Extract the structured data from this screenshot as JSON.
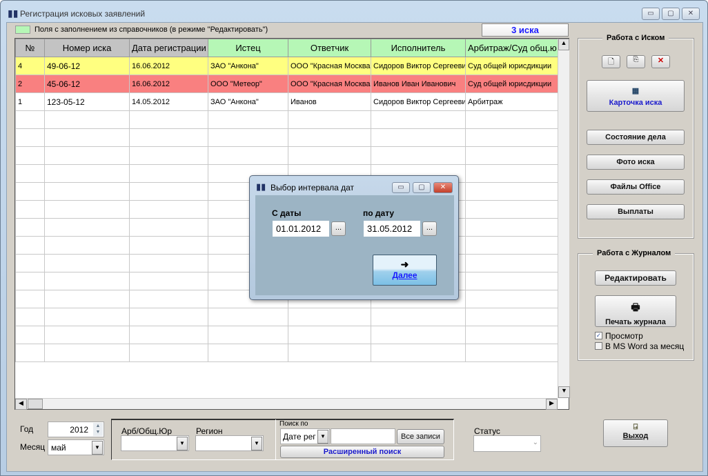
{
  "window": {
    "title": "Регистрация исковых заявлений",
    "minimize": "▭",
    "maximize": "▢",
    "close": "✕"
  },
  "legend": {
    "text": "Поля с заполнением из справочников (в режиме \"Редактировать\")",
    "color": "#b6f7b6"
  },
  "count_label": "3 иска",
  "table": {
    "columns": [
      "№",
      "Номер иска",
      "Дата регистрации",
      "Истец",
      "Ответчик",
      "Исполнитель",
      "Арбитраж/Суд общ.ю"
    ],
    "rows": [
      [
        "4",
        "49-06-12",
        "16.06.2012",
        "ЗАО \"Анкона\"",
        "ООО \"Красная Москва\"",
        "Сидоров Виктор Сергеевич",
        "Суд общей юрисдикции"
      ],
      [
        "2",
        "45-06-12",
        "16.06.2012",
        "ООО \"Метеор\"",
        "ООО \"Красная Москва\"",
        "Иванов Иван Иванович",
        "Суд общей юрисдикции"
      ],
      [
        "1",
        "123-05-12",
        "14.05.2012",
        "ЗАО \"Анкона\"",
        "Иванов",
        "Сидоров Виктор Сергеевич",
        "Арбитраж"
      ]
    ],
    "row_colors": [
      "#ffff80",
      "#f98080",
      "#ffffff"
    ]
  },
  "claim_panel": {
    "title": "Работа с Иском",
    "card": "Карточка иска",
    "status": "Состояние дела",
    "photo": "Фото иска",
    "office": "Файлы Office",
    "payments": "Выплаты"
  },
  "journal_panel": {
    "title": "Работа с Журналом",
    "edit": "Редактировать",
    "print": "Печать журнала",
    "preview": {
      "label": "Просмотр",
      "checked": true
    },
    "word": {
      "label": "В MS Word за месяц",
      "checked": false
    }
  },
  "filters": {
    "year_label": "Год",
    "year": "2012",
    "month_label": "Месяц",
    "month": "май",
    "arb_label": "Арб/Общ.Юр",
    "region_label": "Регион",
    "search_by_label": "Поиск по",
    "search_by": "Дате рег",
    "search_value": "",
    "all_records": "Все записи",
    "advanced_search": "Расширенный поиск",
    "status_label": "Статус"
  },
  "exit": "Выход",
  "dialog": {
    "title": "Выбор интервала дат",
    "from_label": "С даты",
    "from": "01.01.2012",
    "to_label": "по дату",
    "to": "31.05.2012",
    "picker": "...",
    "next": "Далее"
  }
}
